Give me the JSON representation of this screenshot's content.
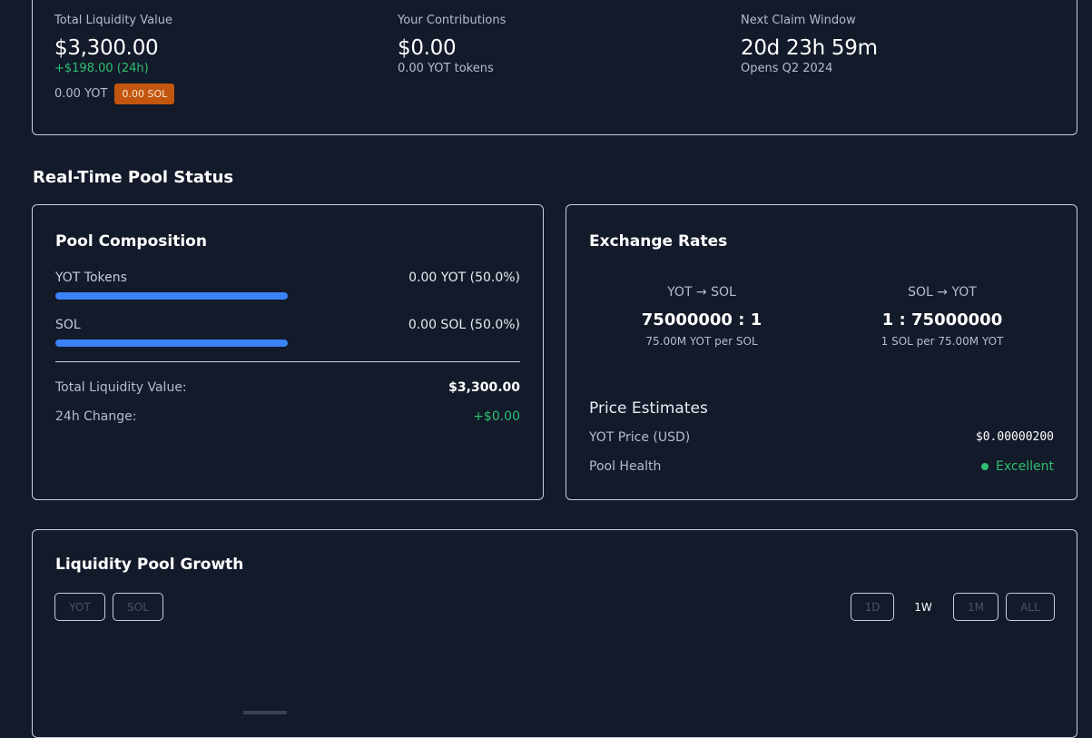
{
  "stats": {
    "total_liquidity": {
      "label": "Total Liquidity Value",
      "value": "$3,300.00",
      "change": "+$198.00 (24h)",
      "yot": "0.00 YOT",
      "sol_badge": "0.00 SOL"
    },
    "contributions": {
      "label": "Your Contributions",
      "value": "$0.00",
      "sub": "0.00 YOT tokens"
    },
    "claim_window": {
      "label": "Next Claim Window",
      "value": "20d 23h 59m",
      "sub": "Opens Q2 2024"
    }
  },
  "section_title": "Real-Time Pool Status",
  "pool_composition": {
    "title": "Pool Composition",
    "rows": [
      {
        "label": "YOT Tokens",
        "value": "0.00 YOT (50.0%)",
        "share": 0.5
      },
      {
        "label": "SOL",
        "value": "0.00 SOL (50.0%)",
        "share": 0.5
      }
    ],
    "total_label": "Total Liquidity Value:",
    "total_value": "$3,300.00",
    "change_label": "24h Change:",
    "change_value": "+$0.00"
  },
  "exchange_rates": {
    "title": "Exchange Rates",
    "yot_to_sol": {
      "label": "YOT → SOL",
      "value": "75000000 : 1",
      "sub": "75.00M YOT per SOL"
    },
    "sol_to_yot": {
      "label": "SOL → YOT",
      "value": "1 : 75000000",
      "sub": "1 SOL per 75.00M YOT"
    },
    "estimates_title": "Price Estimates",
    "yot_price_label": "YOT Price (USD)",
    "yot_price_value": "$0.00000200",
    "health_label": "Pool Health",
    "health_value": "Excellent"
  },
  "growth": {
    "title": "Liquidity Pool Growth",
    "token_buttons": [
      "YOT",
      "SOL"
    ],
    "range_buttons": [
      "1D",
      "1W",
      "1M",
      "ALL"
    ],
    "active_range": "1W"
  },
  "colors": {
    "accent": "#3b82f6",
    "positive": "#2fbf71",
    "badge": "#c2560f",
    "background": "#131a2a"
  }
}
